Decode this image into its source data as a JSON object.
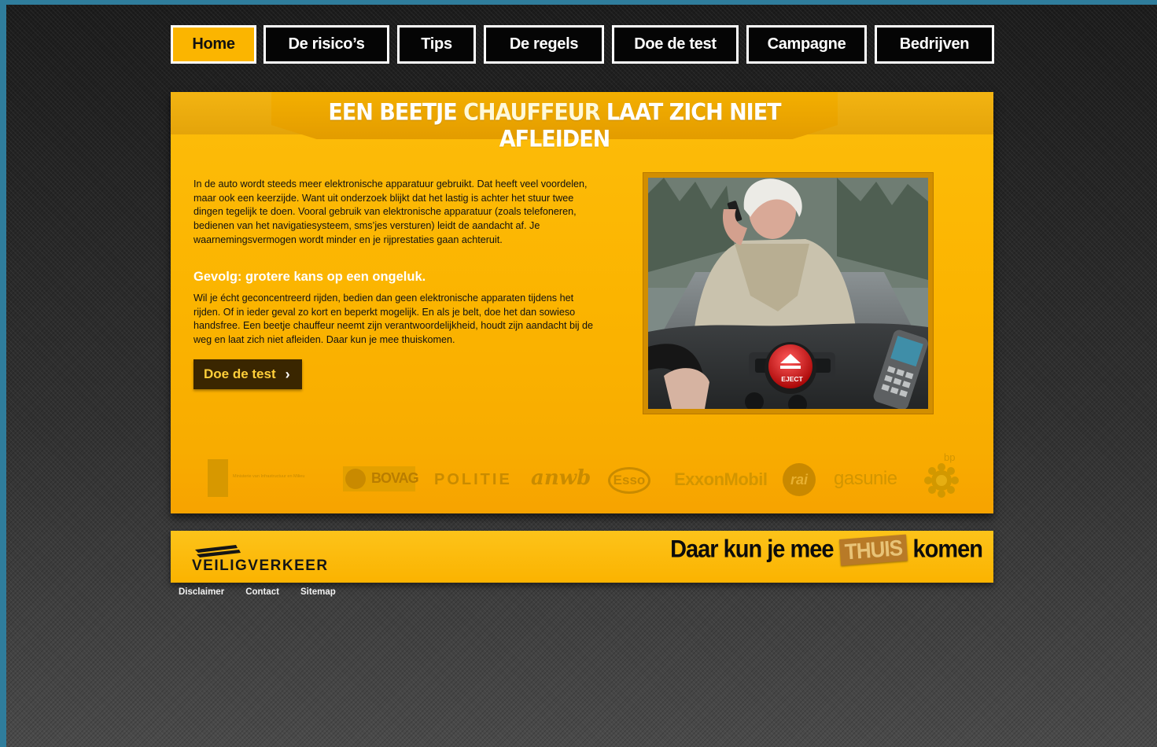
{
  "nav": {
    "items": [
      {
        "label": "Home",
        "active": true
      },
      {
        "label": "De risico’s",
        "active": false
      },
      {
        "label": "Tips",
        "active": false
      },
      {
        "label": "De regels",
        "active": false
      },
      {
        "label": "Doe de test",
        "active": false
      },
      {
        "label": "Campagne",
        "active": false
      },
      {
        "label": "Bedrijven",
        "active": false
      }
    ]
  },
  "main": {
    "headline_part1": "EEN BEETJE ",
    "headline_part2": "CHAUFFEUR",
    "headline_part3": " LAAT ZICH NIET AFLEIDEN",
    "intro": "In de auto wordt steeds meer elektronische apparatuur gebruikt. Dat heeft veel voordelen, maar ook een keerzijde. Want uit onderzoek blijkt dat het lastig is achter het stuur twee dingen tegelijk te doen. Vooral gebruik van elektronische apparatuur (zoals telefoneren, bedienen van het navigatiesysteem, sms’jes versturen) leidt de aandacht af. Je waarnemingsvermogen wordt minder en je rijprestaties gaan achteruit.",
    "subheading": "Gevolg: grotere kans op een ongeluk.",
    "body": "Wil je écht geconcentreerd rijden, bedien dan geen elektronische apparaten tijdens het rijden. Of in ieder geval zo kort en beperkt mogelijk. En als je belt, doe het dan sowieso handsfree. Een beetje chauffeur neemt zijn verantwoordelijkheid, houdt zijn aandacht bij de weg en laat zich niet afleiden. Daar kun je mee thuiskomen.",
    "cta_label": "Doe de test",
    "cta_chevron": "›",
    "image_eject_label": "EJECT"
  },
  "logos": {
    "ministry": "Ministerie van Infrastructuur en Milieu",
    "bovag": "BOVAG",
    "politie": "POLITIE",
    "anwb": "anwb",
    "esso": "Esso",
    "exxon": "ExxonMobil",
    "rai": "rai",
    "gasunie": "gasunie",
    "bp": "bp"
  },
  "footer": {
    "brand": "VEILIGVERKEER",
    "slogan_part1": "Daar kun je mee",
    "slogan_thuis": "THUIS",
    "slogan_part2": "komen",
    "links": [
      "Disclaimer",
      "Contact",
      "Sitemap"
    ]
  },
  "colors": {
    "accent": "#fbb500",
    "nav_bg": "#050505",
    "cta_bg": "#3a2600"
  }
}
